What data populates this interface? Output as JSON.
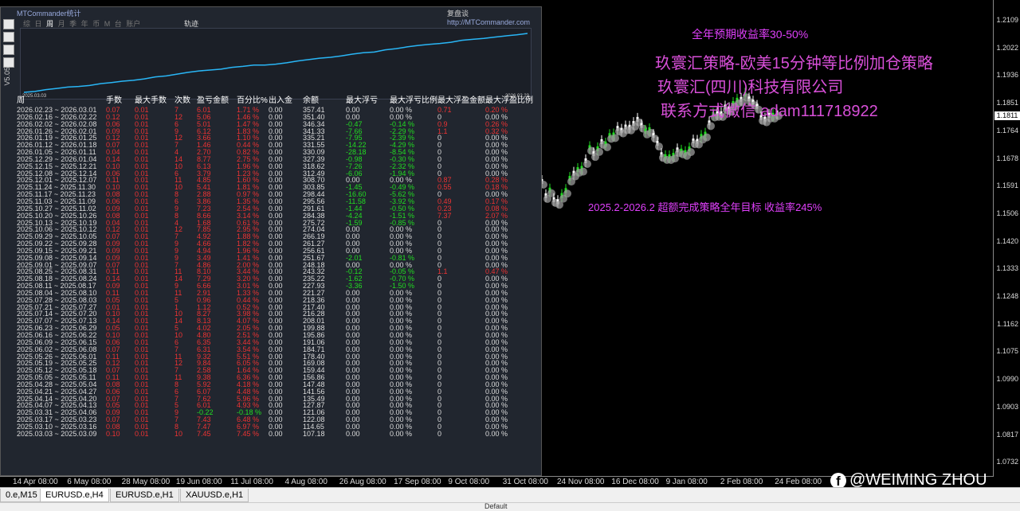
{
  "price_axis": {
    "labels": [
      "1.2109",
      "1.2022",
      "1.1936",
      "1.1851",
      "1.1764",
      "1.1678",
      "1.1591",
      "1.1506",
      "1.1420",
      "1.1333",
      "1.1248",
      "1.1162",
      "1.1075",
      "1.0990",
      "1.0903",
      "1.0817",
      "1.0732"
    ],
    "current": "1.1811"
  },
  "time_axis": [
    "14 Apr 08:00",
    "6 May 08:00",
    "28 May 08:00",
    "19 Jun 08:00",
    "11 Jul 08:00",
    "4 Aug 08:00",
    "26 Aug 08:00",
    "17 Sep 08:00",
    "9 Oct 08:00",
    "31 Oct 08:00",
    "24 Nov 08:00",
    "16 Dec 08:00",
    "9 Jan 08:00",
    "2 Feb 08:00",
    "24 Feb 08:00"
  ],
  "tabs": [
    "0.e,M15",
    "EURUSD.e,H4",
    "EURUSD.e,H1",
    "XAUUSD.e,H1"
  ],
  "active_tab": "EURUSD.e,H4",
  "panel": {
    "title": "MTCommander统计",
    "link_prefix": "复盘谈",
    "link": "http://MTCommander.com",
    "version": "V5.05",
    "periods": [
      "综",
      "日",
      "周",
      "月",
      "季",
      "年",
      "币",
      "M",
      "台",
      "账户"
    ],
    "selected_period": "周",
    "trend_label": "轨迹",
    "equity_start_date": "2025.03.03",
    "equity_end_date": "2026.02.23",
    "equity_curve": [
      98,
      102,
      110,
      115,
      121,
      124,
      128,
      136,
      141,
      147,
      151,
      157,
      166,
      170,
      178,
      186,
      192,
      196,
      200,
      208,
      212,
      218,
      218,
      222,
      228,
      236,
      242,
      248,
      252,
      258,
      266,
      272,
      275,
      285,
      290,
      298,
      304,
      309,
      313,
      318,
      327,
      331,
      335,
      341,
      346,
      351,
      357
    ],
    "headers": [
      "周",
      "手数",
      "最大手数",
      "次数",
      "盈亏金额",
      "百分比%",
      "出入金",
      "余额",
      "最大浮亏",
      "最大浮亏比例",
      "最大浮盈金额",
      "最大浮盈比例"
    ],
    "rows": [
      [
        "2026.02.23 ~ 2026.03.01",
        "0.07",
        "0.01",
        "7",
        "6.01",
        "1.71 %",
        "0.00",
        "357.41",
        "0.00",
        "0.00 %",
        "0.71",
        "0.20 %"
      ],
      [
        "2026.02.16 ~ 2026.02.22",
        "0.12",
        "0.01",
        "12",
        "5.06",
        "1.46 %",
        "0.00",
        "351.40",
        "0.00",
        "0.00 %",
        "0",
        "0.00 %"
      ],
      [
        "2026.02.02 ~ 2026.02.08",
        "0.06",
        "0.01",
        "6",
        "5.01",
        "1.47 %",
        "0.00",
        "346.34",
        "-0.47",
        "-0.14 %",
        "0.9",
        "0.26 %"
      ],
      [
        "2026.01.26 ~ 2026.02.01",
        "0.09",
        "0.01",
        "9",
        "6.12",
        "1.83 %",
        "0.00",
        "341.33",
        "-7.66",
        "-2.29 %",
        "1.1",
        "0.32 %"
      ],
      [
        "2026.01.19 ~ 2026.01.25",
        "0.12",
        "0.01",
        "12",
        "3.66",
        "1.10 %",
        "0.00",
        "335.21",
        "-7.95",
        "-2.39 %",
        "0",
        "0.00 %"
      ],
      [
        "2026.01.12 ~ 2026.01.18",
        "0.07",
        "0.01",
        "7",
        "1.46",
        "0.44 %",
        "0.00",
        "331.55",
        "-14.22",
        "-4.29 %",
        "0",
        "0.00 %"
      ],
      [
        "2026.01.05 ~ 2026.01.11",
        "0.04",
        "0.01",
        "4",
        "2.70",
        "0.82 %",
        "0.00",
        "330.09",
        "-28.18",
        "-8.54 %",
        "0",
        "0.00 %"
      ],
      [
        "2025.12.29 ~ 2026.01.04",
        "0.14",
        "0.01",
        "14",
        "8.77",
        "2.75 %",
        "0.00",
        "327.39",
        "-0.98",
        "-0.30 %",
        "0",
        "0.00 %"
      ],
      [
        "2025.12.15 ~ 2025.12.21",
        "0.10",
        "0.01",
        "10",
        "6.13",
        "1.96 %",
        "0.00",
        "318.62",
        "-7.26",
        "-2.32 %",
        "0",
        "0.00 %"
      ],
      [
        "2025.12.08 ~ 2025.12.14",
        "0.06",
        "0.01",
        "6",
        "3.79",
        "1.23 %",
        "0.00",
        "312.49",
        "-6.06",
        "-1.94 %",
        "0",
        "0.00 %"
      ],
      [
        "2025.12.01 ~ 2025.12.07",
        "0.11",
        "0.01",
        "11",
        "4.85",
        "1.60 %",
        "0.00",
        "308.70",
        "0.00",
        "0.00 %",
        "0.87",
        "0.28 %"
      ],
      [
        "2025.11.24 ~ 2025.11.30",
        "0.10",
        "0.01",
        "10",
        "5.41",
        "1.81 %",
        "0.00",
        "303.85",
        "-1.45",
        "-0.49 %",
        "0.55",
        "0.18 %"
      ],
      [
        "2025.11.17 ~ 2025.11.23",
        "0.08",
        "0.01",
        "8",
        "2.88",
        "0.97 %",
        "0.00",
        "298.44",
        "-16.60",
        "-5.62 %",
        "0",
        "0.00 %"
      ],
      [
        "2025.11.03 ~ 2025.11.09",
        "0.06",
        "0.01",
        "6",
        "3.86",
        "1.35 %",
        "0.00",
        "295.56",
        "-11.58",
        "-3.92 %",
        "0.49",
        "0.17 %"
      ],
      [
        "2025.10.27 ~ 2025.11.02",
        "0.09",
        "0.01",
        "9",
        "7.23",
        "2.54 %",
        "0.00",
        "291.61",
        "-1.44",
        "-0.50 %",
        "0.23",
        "0.08 %"
      ],
      [
        "2025.10.20 ~ 2025.10.26",
        "0.08",
        "0.01",
        "8",
        "8.66",
        "3.14 %",
        "0.00",
        "284.38",
        "-4.24",
        "-1.51 %",
        "7.37",
        "2.07 %"
      ],
      [
        "2025.10.13 ~ 2025.10.19",
        "0.04",
        "0.01",
        "4",
        "1.68",
        "0.61 %",
        "0.00",
        "275.72",
        "-1.59",
        "-0.85 %",
        "0",
        "0.00 %"
      ],
      [
        "2025.10.06 ~ 2025.10.12",
        "0.12",
        "0.01",
        "12",
        "7.85",
        "2.95 %",
        "0.00",
        "274.04",
        "0.00",
        "0.00 %",
        "0",
        "0.00 %"
      ],
      [
        "2025.09.29 ~ 2025.10.05",
        "0.07",
        "0.01",
        "7",
        "4.92",
        "1.88 %",
        "0.00",
        "266.19",
        "0.00",
        "0.00 %",
        "0",
        "0.00 %"
      ],
      [
        "2025.09.22 ~ 2025.09.28",
        "0.09",
        "0.01",
        "9",
        "4.66",
        "1.82 %",
        "0.00",
        "261.27",
        "0.00",
        "0.00 %",
        "0",
        "0.00 %"
      ],
      [
        "2025.09.15 ~ 2025.09.21",
        "0.09",
        "0.01",
        "9",
        "4.94",
        "1.96 %",
        "0.00",
        "256.61",
        "0.00",
        "0.00 %",
        "0",
        "0.00 %"
      ],
      [
        "2025.09.08 ~ 2025.09.14",
        "0.09",
        "0.01",
        "9",
        "3.49",
        "1.41 %",
        "0.00",
        "251.67",
        "-2.01",
        "-0.81 %",
        "0",
        "0.00 %"
      ],
      [
        "2025.09.01 ~ 2025.09.07",
        "0.07",
        "0.01",
        "7",
        "4.86",
        "2.00 %",
        "0.00",
        "248.18",
        "0.00",
        "0.00 %",
        "0",
        "0.00 %"
      ],
      [
        "2025.08.25 ~ 2025.08.31",
        "0.11",
        "0.01",
        "11",
        "8.10",
        "3.44 %",
        "0.00",
        "243.32",
        "-0.12",
        "-0.05 %",
        "1.1",
        "0.47 %"
      ],
      [
        "2025.08.18 ~ 2025.08.24",
        "0.14",
        "0.01",
        "14",
        "7.29",
        "3.20 %",
        "0.00",
        "235.22",
        "-1.62",
        "-0.70 %",
        "0",
        "0.00 %"
      ],
      [
        "2025.08.11 ~ 2025.08.17",
        "0.09",
        "0.01",
        "9",
        "6.66",
        "3.01 %",
        "0.00",
        "227.93",
        "-3.36",
        "-1.50 %",
        "0",
        "0.00 %"
      ],
      [
        "2025.08.04 ~ 2025.08.10",
        "0.11",
        "0.01",
        "11",
        "2.91",
        "1.33 %",
        "0.00",
        "221.27",
        "0.00",
        "0.00 %",
        "0",
        "0.00 %"
      ],
      [
        "2025.07.28 ~ 2025.08.03",
        "0.05",
        "0.01",
        "5",
        "0.96",
        "0.44 %",
        "0.00",
        "218.36",
        "0.00",
        "0.00 %",
        "0",
        "0.00 %"
      ],
      [
        "2025.07.21 ~ 2025.07.27",
        "0.01",
        "0.01",
        "1",
        "1.12",
        "0.52 %",
        "0.00",
        "217.40",
        "0.00",
        "0.00 %",
        "0",
        "0.00 %"
      ],
      [
        "2025.07.14 ~ 2025.07.20",
        "0.10",
        "0.01",
        "10",
        "8.27",
        "3.98 %",
        "0.00",
        "216.28",
        "0.00",
        "0.00 %",
        "0",
        "0.00 %"
      ],
      [
        "2025.07.07 ~ 2025.07.13",
        "0.14",
        "0.01",
        "14",
        "8.13",
        "4.07 %",
        "0.00",
        "208.01",
        "0.00",
        "0.00 %",
        "0",
        "0.00 %"
      ],
      [
        "2025.06.23 ~ 2025.06.29",
        "0.05",
        "0.01",
        "5",
        "4.02",
        "2.05 %",
        "0.00",
        "199.88",
        "0.00",
        "0.00 %",
        "0",
        "0.00 %"
      ],
      [
        "2025.06.16 ~ 2025.06.22",
        "0.10",
        "0.01",
        "10",
        "4.80",
        "2.51 %",
        "0.00",
        "195.86",
        "0.00",
        "0.00 %",
        "0",
        "0.00 %"
      ],
      [
        "2025.06.09 ~ 2025.06.15",
        "0.06",
        "0.01",
        "6",
        "6.35",
        "3.44 %",
        "0.00",
        "191.06",
        "0.00",
        "0.00 %",
        "0",
        "0.00 %"
      ],
      [
        "2025.06.02 ~ 2025.06.08",
        "0.07",
        "0.01",
        "7",
        "6.31",
        "3.54 %",
        "0.00",
        "184.71",
        "0.00",
        "0.00 %",
        "0",
        "0.00 %"
      ],
      [
        "2025.05.26 ~ 2025.06.01",
        "0.11",
        "0.01",
        "11",
        "9.32",
        "5.51 %",
        "0.00",
        "178.40",
        "0.00",
        "0.00 %",
        "0",
        "0.00 %"
      ],
      [
        "2025.05.19 ~ 2025.05.25",
        "0.12",
        "0.01",
        "12",
        "9.84",
        "6.05 %",
        "0.00",
        "169.08",
        "0.00",
        "0.00 %",
        "0",
        "0.00 %"
      ],
      [
        "2025.05.12 ~ 2025.05.18",
        "0.07",
        "0.01",
        "7",
        "2.58",
        "1.64 %",
        "0.00",
        "159.44",
        "0.00",
        "0.00 %",
        "0",
        "0.00 %"
      ],
      [
        "2025.05.05 ~ 2025.05.11",
        "0.11",
        "0.01",
        "11",
        "9.38",
        "6.36 %",
        "0.00",
        "156.86",
        "0.00",
        "0.00 %",
        "0",
        "0.00 %"
      ],
      [
        "2025.04.28 ~ 2025.05.04",
        "0.08",
        "0.01",
        "8",
        "5.92",
        "4.18 %",
        "0.00",
        "147.48",
        "0.00",
        "0.00 %",
        "0",
        "0.00 %"
      ],
      [
        "2025.04.21 ~ 2025.04.27",
        "0.06",
        "0.01",
        "6",
        "6.07",
        "4.48 %",
        "0.00",
        "141.56",
        "0.00",
        "0.00 %",
        "0",
        "0.00 %"
      ],
      [
        "2025.04.14 ~ 2025.04.20",
        "0.07",
        "0.01",
        "7",
        "7.62",
        "5.96 %",
        "0.00",
        "135.49",
        "0.00",
        "0.00 %",
        "0",
        "0.00 %"
      ],
      [
        "2025.04.07 ~ 2025.04.13",
        "0.05",
        "0.01",
        "5",
        "6.01",
        "4.93 %",
        "0.00",
        "127.87",
        "0.00",
        "0.00 %",
        "0",
        "0.00 %"
      ],
      [
        "2025.03.31 ~ 2025.04.06",
        "0.09",
        "0.01",
        "9",
        "-0.22",
        "-0.18 %",
        "0.00",
        "121.06",
        "0.00",
        "0.00 %",
        "0",
        "0.00 %"
      ],
      [
        "2025.03.17 ~ 2025.03.23",
        "0.07",
        "0.01",
        "7",
        "7.43",
        "6.48 %",
        "0.00",
        "122.08",
        "0.00",
        "0.00 %",
        "0",
        "0.00 %"
      ],
      [
        "2025.03.10 ~ 2025.03.16",
        "0.08",
        "0.01",
        "8",
        "7.47",
        "6.97 %",
        "0.00",
        "114.65",
        "0.00",
        "0.00 %",
        "0",
        "0.00 %"
      ],
      [
        "2025.03.03 ~ 2025.03.09",
        "0.10",
        "0.01",
        "10",
        "7.45",
        "7.45 %",
        "0.00",
        "107.18",
        "0.00",
        "0.00 %",
        "0",
        "0.00 %"
      ]
    ]
  },
  "overlay": {
    "target_line": "全年预期收益率30-50%",
    "strategy_line": "玖寰汇策略-欧美15分钟等比例加仓策略",
    "company_line": "玖寰汇(四川)科技有限公司",
    "contact_line": "联系方式微信 adam111718922",
    "result_line": "2025.2-2026.2 超额完成策略全年目标 收益率245%",
    "colors": {
      "target": "#e040fb",
      "strategy": "#d84fd8",
      "result": "#e040fb"
    }
  },
  "watermark": "@WEIMING ZHOU",
  "status": {
    "text": "Default"
  }
}
